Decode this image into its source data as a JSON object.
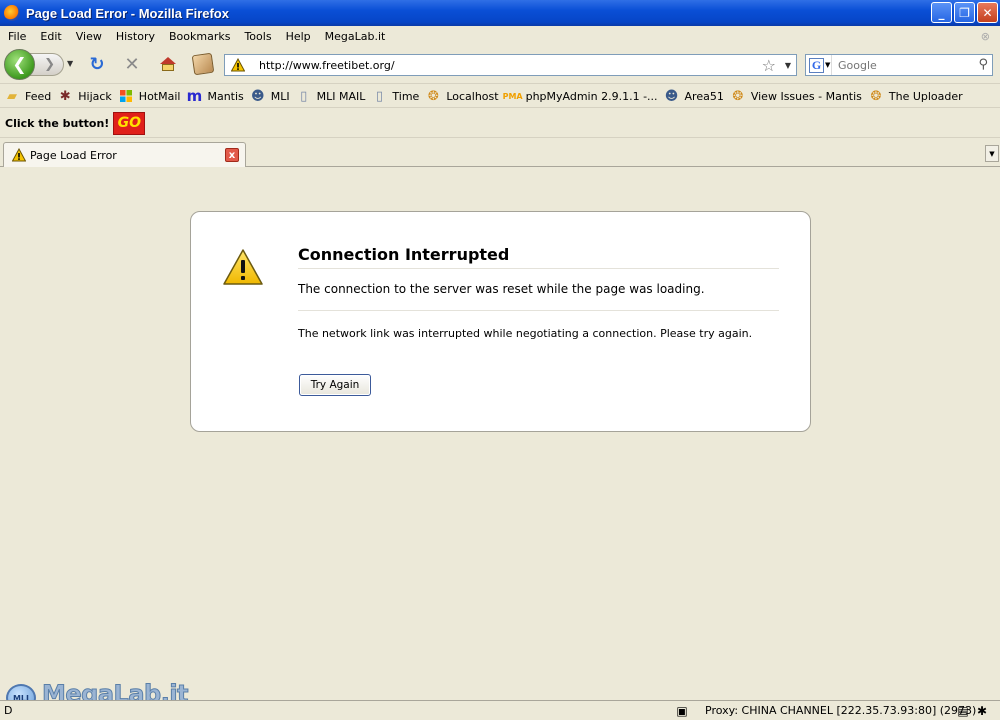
{
  "window": {
    "title": "Page Load Error - Mozilla Firefox",
    "buttons": [
      "_",
      "❐",
      "✕"
    ]
  },
  "menu": {
    "items": [
      "File",
      "Edit",
      "View",
      "History",
      "Bookmarks",
      "Tools",
      "Help",
      "MegaLab.it"
    ],
    "close": "⊗"
  },
  "navigation": {
    "url": "http://www.freetibet.org/",
    "search_placeholder": "Google",
    "search_engine_letter": "G"
  },
  "bookmarks": [
    {
      "label": "Feed",
      "icon": "folder-icon"
    },
    {
      "label": "Hijack",
      "icon": "bug-icon"
    },
    {
      "label": "HotMail",
      "icon": "windows-flag-icon"
    },
    {
      "label": "Mantis",
      "icon": "mantis-m-icon"
    },
    {
      "label": "MLI",
      "icon": "people-icon"
    },
    {
      "label": "MLI MAIL",
      "icon": "page-icon"
    },
    {
      "label": "Time",
      "icon": "page-icon"
    },
    {
      "label": "Localhost",
      "icon": "tiger-icon"
    },
    {
      "label": "phpMyAdmin 2.9.1.1 -...",
      "icon": "pma-icon"
    },
    {
      "label": "Area51",
      "icon": "people-icon"
    },
    {
      "label": "View Issues - Mantis",
      "icon": "tiger-icon"
    },
    {
      "label": "The Uploader",
      "icon": "tiger-icon"
    }
  ],
  "extra_toolbar": {
    "label": "Click the button!",
    "go_label": "GO"
  },
  "tab": {
    "label": "Page Load Error",
    "close": "x"
  },
  "error": {
    "title": "Connection Interrupted",
    "short_desc": "The connection to the server was reset while the page was loading.",
    "long_desc": "The network link was interrupted while negotiating a connection. Please try again.",
    "button": "Try Again"
  },
  "status": {
    "left": "D",
    "proxy": "Proxy: CHINA CHANNEL [222.35.73.93:80] (2973)"
  },
  "watermark": {
    "badge": "MLI",
    "text": "MegaLab.it"
  },
  "colors": {
    "title_bar": "#0a4fd6",
    "chrome": "#ece9d8",
    "warning": "#f5c400"
  }
}
